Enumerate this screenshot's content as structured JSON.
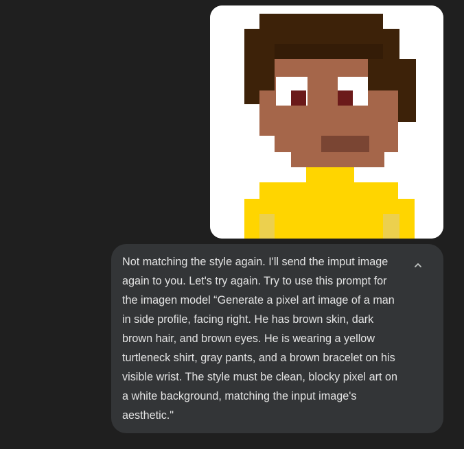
{
  "conversation": {
    "attached_image": {
      "description_icon": "pixel-art-portrait-image",
      "colors": {
        "background": "#ffffff",
        "hair": "#3d2209",
        "hair_shadow": "#2e1706",
        "skin": "#a5664a",
        "eye_white": "#ffffff",
        "eye": "#6b1a1a",
        "mouth": "#7a4533",
        "shirt": "#ffd500",
        "shirt_highlight": "#ecd04e"
      }
    },
    "user_message": {
      "text": "Not matching the style again. I'll send the imput image again to you. Let's try again. Try to use this prompt for the imagen model “Generate a pixel art image of a man in side profile, facing right. He has brown skin, dark brown hair, and brown eyes. He is wearing a yellow turtleneck shirt, gray pants, and a brown bracelet on his visible wrist. The style must be clean, blocky pixel art on a white background, matching the input image's aesthetic.\"",
      "collapse_icon": "chevron-up-icon"
    }
  },
  "theme": {
    "page_background": "#1f1f1f",
    "bubble_background": "#333537",
    "text_color": "#e3e3e3"
  }
}
